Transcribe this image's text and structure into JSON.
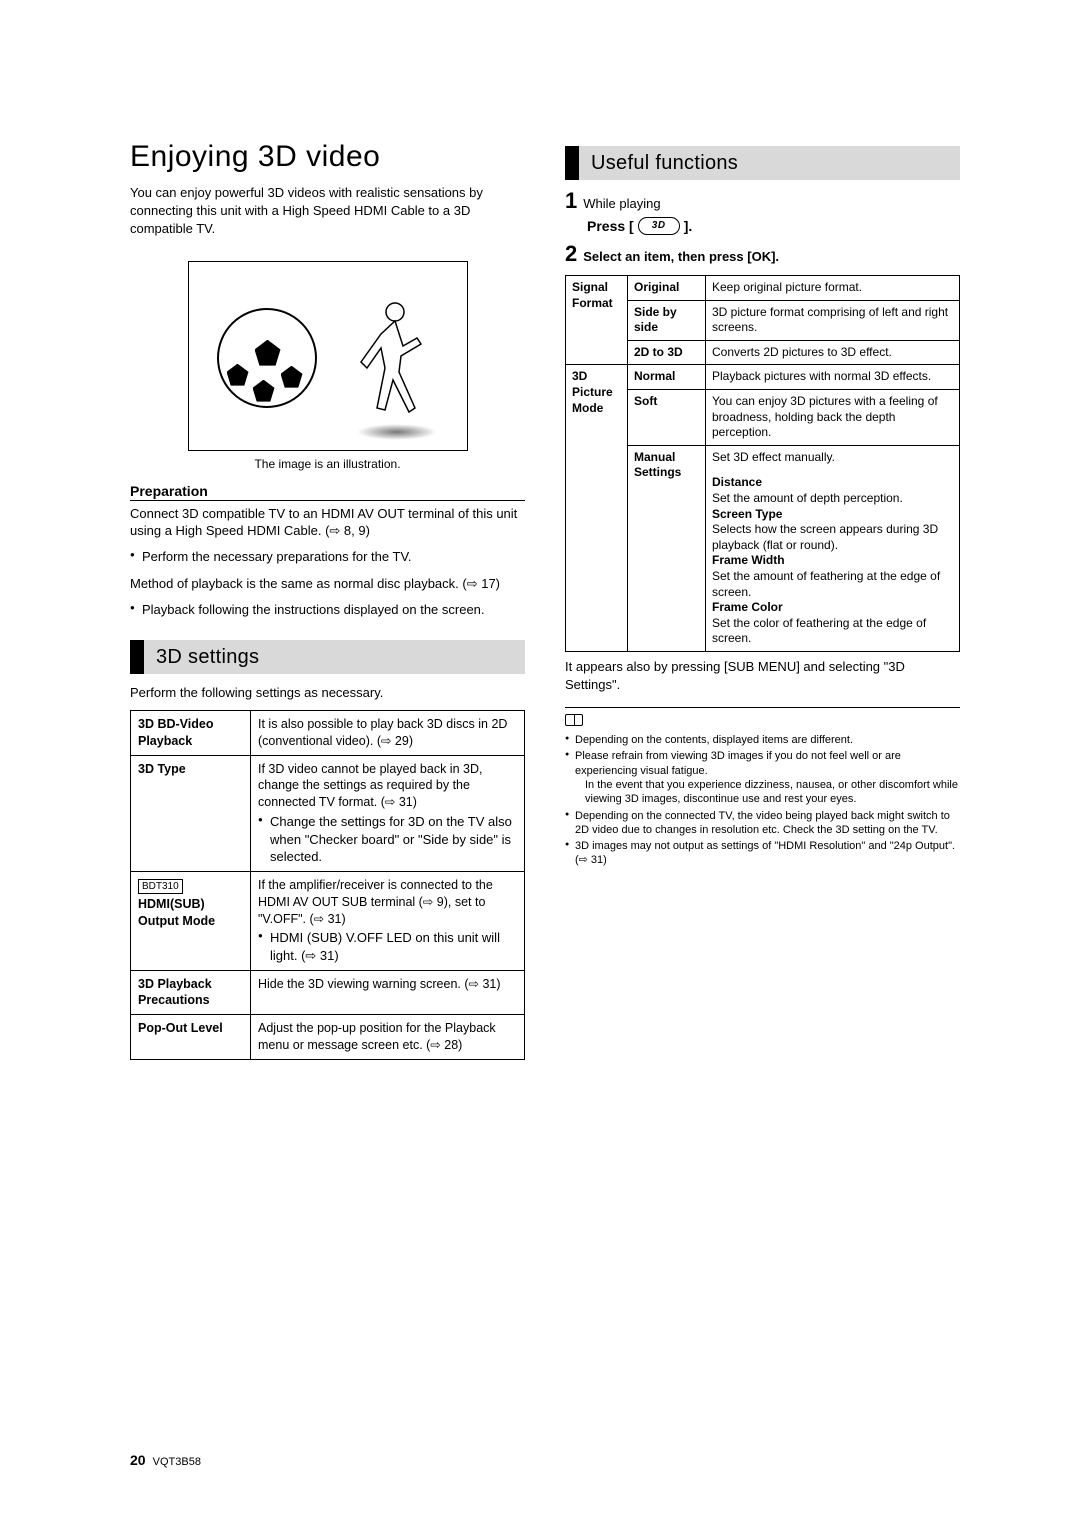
{
  "title": "Enjoying 3D video",
  "intro": "You can enjoy powerful 3D videos with realistic sensations by connecting this unit with a High Speed HDMI Cable to a 3D compatible TV.",
  "illus_caption": "The image is an illustration.",
  "prep_heading": "Preparation",
  "prep_para": "Connect 3D compatible TV to an HDMI AV OUT terminal of this unit using a High Speed HDMI Cable. (⇨ 8, 9)",
  "prep_bullet1": "Perform the necessary preparations for the TV.",
  "method_para": "Method of playback is the same as normal disc playback. (⇨ 17)",
  "method_bullet1": "Playback following the instructions displayed on the screen.",
  "sec_3d_settings": "3D settings",
  "settings_intro": "Perform the following settings as necessary.",
  "settings_rows": {
    "r1_lbl": "3D BD-Video Playback",
    "r1_txt": "It is also possible to play back 3D discs in 2D (conventional video). (⇨ 29)",
    "r2_lbl": "3D Type",
    "r2_txt_a": "If 3D video cannot be played back in 3D, change the settings as required by the connected TV format. (⇨ 31)",
    "r2_txt_b": "Change the settings for 3D on the TV also when \"Checker board\" or \"Side by side\" is selected.",
    "r3_model": "BDT310",
    "r3_lbl": "HDMI(SUB) Output Mode",
    "r3_txt_a": "If the amplifier/receiver is connected to the HDMI AV OUT SUB terminal (⇨ 9), set to \"V.OFF\". (⇨ 31)",
    "r3_txt_b": "HDMI (SUB) V.OFF LED on this unit will light. (⇨ 31)",
    "r4_lbl": "3D Playback Precautions",
    "r4_txt": "Hide the 3D viewing warning screen. (⇨ 31)",
    "r5_lbl": "Pop-Out Level",
    "r5_txt": "Adjust the pop-up position for the Playback menu or message screen etc. (⇨ 28)"
  },
  "sec_useful": "Useful functions",
  "step1_txt": "While playing",
  "press_label": "Press [",
  "press_close": "].",
  "step2_txt": "Select an item, then press [OK].",
  "func": {
    "group1": "Signal Format",
    "g1r1_opt": "Original",
    "g1r1_txt": "Keep original picture format.",
    "g1r2_opt": "Side by side",
    "g1r2_txt": "3D picture format comprising of left and right screens.",
    "g1r3_opt": "2D to 3D",
    "g1r3_txt": "Converts 2D pictures to 3D effect.",
    "group2": "3D Picture Mode",
    "g2r1_opt": "Normal",
    "g2r1_txt": "Playback pictures with normal 3D effects.",
    "g2r2_opt": "Soft",
    "g2r2_txt": "You can enjoy 3D pictures with a feeling of broadness, holding back the depth perception.",
    "g2r3_opt": "Manual Settings",
    "g2r3_intro": "Set 3D effect manually.",
    "g2r3_h1": "Distance",
    "g2r3_t1": "Set the amount of depth perception.",
    "g2r3_h2": "Screen Type",
    "g2r3_t2": "Selects how the screen appears during 3D playback (flat or round).",
    "g2r3_h3": "Frame Width",
    "g2r3_t3": "Set the amount of feathering at the edge of screen.",
    "g2r3_h4": "Frame Color",
    "g2r3_t4": "Set the color of feathering at the edge of screen."
  },
  "after_table": "It appears also by pressing [SUB MENU] and selecting \"3D Settings\".",
  "notes": {
    "n1": "Depending on the contents, displayed items are different.",
    "n2a": "Please refrain from viewing 3D images if you do not feel well or are experiencing visual fatigue.",
    "n2b": "In the event that you experience dizziness, nausea, or other discomfort while viewing 3D images, discontinue use and rest your eyes.",
    "n3": "Depending on the connected TV, the video being played back might switch to 2D video due to changes in resolution etc. Check the 3D setting on the TV.",
    "n4": "3D images may not output as settings of \"HDMI Resolution\" and \"24p Output\". (⇨ 31)"
  },
  "footer_page": "20",
  "footer_code": "VQT3B58"
}
